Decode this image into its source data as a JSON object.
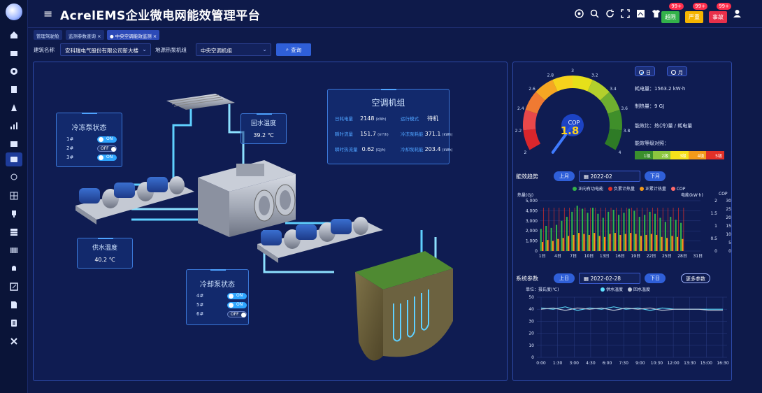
{
  "app": {
    "title": "AcrelEMS企业微电网能效管理平台"
  },
  "topbar": {
    "badges": [
      {
        "label": "越限",
        "count": "99+",
        "color": "#33b24a"
      },
      {
        "label": "严重",
        "count": "99+",
        "color": "#f5b400"
      },
      {
        "label": "事故",
        "count": "99+",
        "color": "#e8304a"
      }
    ]
  },
  "tabs": [
    "管理驾驶舱",
    "监测参数查询 ×",
    "● 中央空调能效监测 ×"
  ],
  "filters": {
    "building_label": "建筑名称",
    "building_value": "安科瑞电气股份有限公司新大楼",
    "source_label": "地源热泵机组",
    "source_value": "中央空调机组",
    "query_label": "查询"
  },
  "scene": {
    "chilled_pump": {
      "title": "冷冻泵状态",
      "rows": [
        {
          "id": "1#",
          "state": "ON",
          "on": true
        },
        {
          "id": "2#",
          "state": "OFF",
          "on": false
        },
        {
          "id": "3#",
          "state": "ON",
          "on": true
        }
      ]
    },
    "return_temp": {
      "title": "回水温度",
      "value": "39.2 ℃"
    },
    "supply_temp": {
      "title": "供水温度",
      "value": "40.2 ℃"
    },
    "cooling_pump": {
      "title": "冷却泵状态",
      "rows": [
        {
          "id": "4#",
          "state": "ON",
          "on": true
        },
        {
          "id": "5#",
          "state": "ON",
          "on": true
        },
        {
          "id": "6#",
          "state": "OFF",
          "on": false
        }
      ]
    },
    "unit": {
      "title": "空调机组",
      "daily_power_label": "日耗电量",
      "daily_power_value": "2148",
      "daily_power_unit": "(kWh)",
      "mode_label": "运行模式",
      "mode_value": "待机",
      "flow_label": "瞬时流量",
      "flow_value": "151.7",
      "flow_unit": "(m³/h)",
      "cold_label": "冷冻泵耗能",
      "cold_value": "371.1",
      "cold_unit": "(kWh)",
      "heat_label": "瞬时热流量",
      "heat_value": "0.62",
      "heat_unit": "(GJ/h)",
      "cool_label": "冷却泵耗能",
      "cool_value": "203.4",
      "cool_unit": "(kWh)"
    }
  },
  "gauge": {
    "label": "COP",
    "value": "1.8",
    "value_num": 1.8,
    "min": 2,
    "max": 4,
    "ticks": [
      "2",
      "2.2",
      "2.4",
      "2.6",
      "2.8",
      "3",
      "3.2",
      "3.4",
      "3.6",
      "3.8",
      "4"
    ]
  },
  "right": {
    "day_label": "日",
    "month_label": "月",
    "power": "耗电量：1563.2 kW·h",
    "heat": "制热量：9 GJ",
    "ratio": "能效比：热(冷)量 / 耗电量",
    "grade": "能效等级对照：",
    "scale": [
      {
        "label": "1级",
        "color": "#3a8f2c"
      },
      {
        "label": "2级",
        "color": "#8cc63f"
      },
      {
        "label": "3级",
        "color": "#f5e21a"
      },
      {
        "label": "4级",
        "color": "#f39a1a"
      },
      {
        "label": "5级",
        "color": "#e03028"
      }
    ],
    "trend_label": "能效趋势",
    "prev_month": "上月",
    "month_value": "2022-02",
    "next_month": "下月",
    "params_label": "系统参数",
    "prev_day": "上日",
    "day_value": "2022-02-28",
    "next_day": "下日",
    "more": "更多参数",
    "temp_unit": "单位：摄氏度(℃)"
  },
  "chart_data": [
    {
      "type": "bar",
      "legend": [
        "正向有功电能",
        "负累计热量",
        "正累计热量",
        "COP"
      ],
      "colors": [
        "#33b24a",
        "#e03028",
        "#f39a1a",
        "#ff6a6a"
      ],
      "ylabel_left": "热量(GJ)",
      "ylabel_right_power": "电能(kW·h)",
      "ylabel_right_cop": "COP",
      "yticks_left": [
        "5,000",
        "4,000",
        "3,000",
        "2,000",
        "1,000",
        "0"
      ],
      "yticks_power": [
        "2",
        "1.5",
        "1",
        "0.5",
        "0"
      ],
      "yticks_cop": [
        "30",
        "25",
        "20",
        "15",
        "10",
        "5",
        "0"
      ],
      "xticks": [
        "1日",
        "4日",
        "7日",
        "10日",
        "13日",
        "16日",
        "19日",
        "22日",
        "25日",
        "28日",
        "31日"
      ],
      "ylim": [
        0,
        5000
      ],
      "days": 28,
      "power": [
        2200,
        2500,
        2300,
        2600,
        3000,
        3400,
        3900,
        4500,
        4200,
        3800,
        4300,
        3700,
        3300,
        3900,
        4100,
        3600,
        3800,
        4200,
        4000,
        3400,
        3600,
        3900,
        3700,
        3300,
        2900,
        3400,
        3100,
        2800
      ],
      "heat": [
        900,
        1100,
        1000,
        1200,
        1300,
        1500,
        1600,
        1800,
        1700,
        1600,
        1800,
        1500,
        1400,
        1700,
        1800,
        1600,
        1700,
        1800,
        1700,
        1500,
        1600,
        1700,
        1600,
        1400,
        1300,
        1500,
        1400,
        1200
      ]
    },
    {
      "type": "line",
      "legend": [
        "供水温度",
        "回水温度"
      ],
      "colors": [
        "#5ee0ff",
        "#c0c8d8"
      ],
      "ylim": [
        0,
        50
      ],
      "yticks": [
        "50",
        "40",
        "30",
        "20",
        "10",
        "0"
      ],
      "xticks": [
        "0:00",
        "1:30",
        "3:00",
        "4:30",
        "6:00",
        "7:30",
        "9:00",
        "10:30",
        "12:00",
        "13:30",
        "15:00",
        "16:30"
      ],
      "supply": [
        41,
        40,
        42,
        39,
        41,
        40,
        42,
        40,
        41,
        39,
        41,
        40,
        40,
        40,
        40,
        40
      ],
      "return": [
        40,
        41,
        39,
        41,
        40,
        41,
        39,
        41,
        40,
        41,
        39,
        40,
        40,
        40,
        39,
        39
      ]
    }
  ]
}
